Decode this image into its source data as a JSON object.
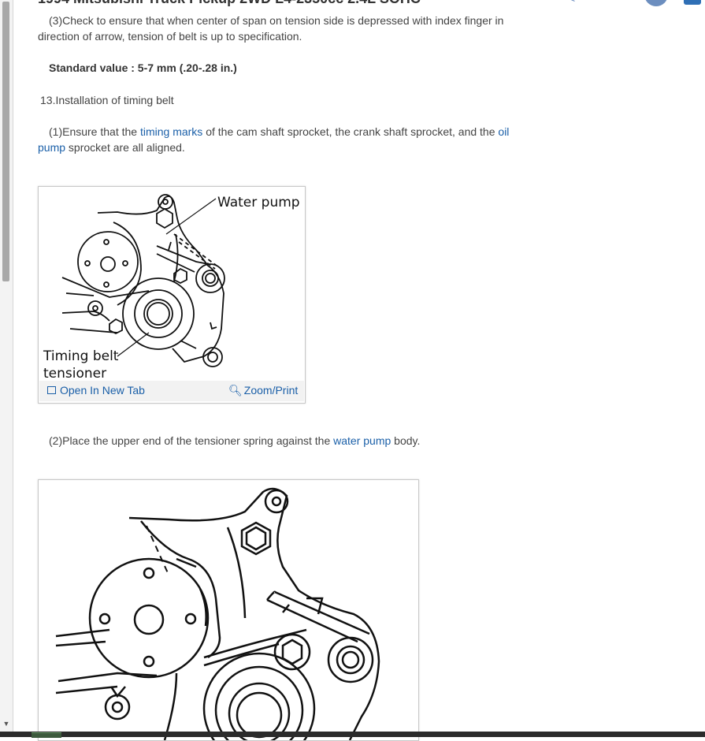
{
  "header": {
    "title": "1994 Mitsubishi Truck Pickup 2WD L4-2350cc 2.4L SOHC"
  },
  "content": {
    "step3_text": "(3)Check to ensure that when center of span on tension side is depressed with index finger in direction of arrow, tension of belt is up to specification.",
    "standard_value": "Standard value : 5-7 mm (.20-.28 in.)",
    "section_heading": "13.Installation of timing belt",
    "step1": {
      "prefix": "(1)Ensure that the ",
      "link1": "timing marks",
      "middle": " of the cam shaft sprocket, the crank shaft sprocket, and the ",
      "link2": "oil pump",
      "suffix": " sprocket are all aligned."
    },
    "step2": {
      "prefix": "(2)Place the upper end of the tensioner spring against the ",
      "link": "water pump",
      "suffix": " body."
    }
  },
  "figure1": {
    "label_water_pump": "Water pump",
    "label_tensioner_line1": "Timing belt",
    "label_tensioner_line2": "tensioner",
    "open_new_tab": "Open In New Tab",
    "zoom_print": "Zoom/Print",
    "open_icon": "open-in-new-tab-icon",
    "zoom_icon": "magnifier-icon"
  },
  "colors": {
    "link": "#1a5fa8",
    "text": "#444444"
  }
}
